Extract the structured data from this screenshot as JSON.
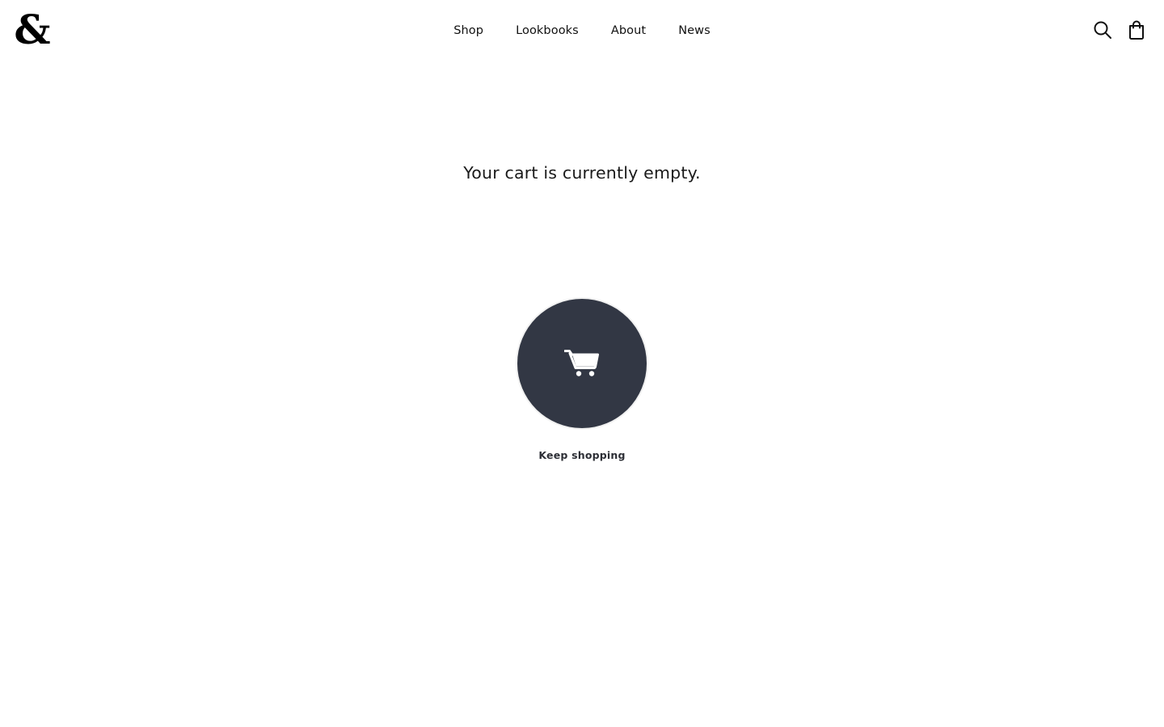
{
  "brand": {
    "logo_text": "&"
  },
  "nav": {
    "items": [
      {
        "label": "Shop"
      },
      {
        "label": "Lookbooks"
      },
      {
        "label": "About"
      },
      {
        "label": "News"
      }
    ]
  },
  "header_icons": {
    "search": "search-icon",
    "cart": "shopping-bag-icon"
  },
  "cart": {
    "empty_message": "Your cart is currently empty.",
    "keep_shopping_label": "Keep shopping",
    "icon": "shopping-cart-icon"
  },
  "colors": {
    "circle_bg": "#323744",
    "text": "#111111"
  }
}
